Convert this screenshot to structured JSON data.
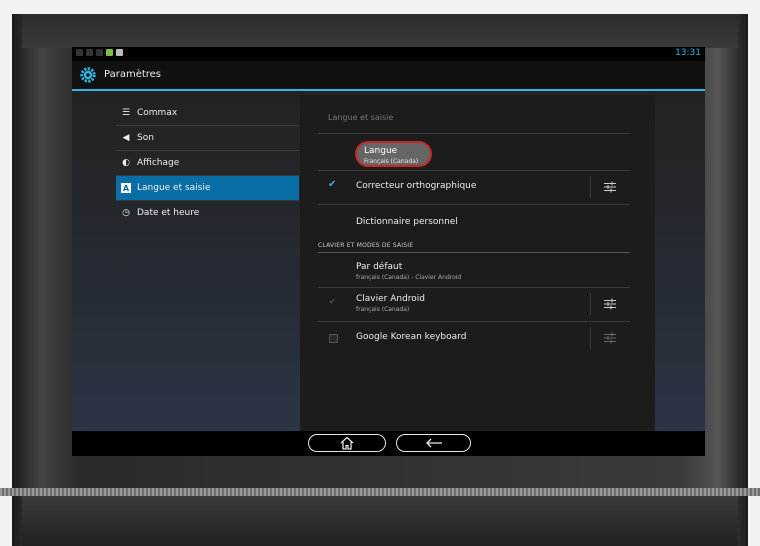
{
  "status_bar": {
    "time": "13:31"
  },
  "action_bar": {
    "title": "Paramètres",
    "icon": "gear-icon"
  },
  "sidebar": {
    "items": [
      {
        "label": "Commax",
        "icon": "list-icon",
        "active": false
      },
      {
        "label": "Son",
        "icon": "speaker-icon",
        "active": false
      },
      {
        "label": "Affichage",
        "icon": "brightness-icon",
        "active": false
      },
      {
        "label": "Langue et saisie",
        "icon": "keyboard-a-icon",
        "active": true
      },
      {
        "label": "Date et heure",
        "icon": "clock-icon",
        "active": false
      }
    ]
  },
  "detail": {
    "title": "Langue et saisie",
    "language": {
      "label": "Langue",
      "value": "Français (Canada)"
    },
    "spellcheck": {
      "label": "Correcteur orthographique",
      "checked": true
    },
    "dictionary": {
      "label": "Dictionnaire personnel"
    },
    "section_header": "CLAVIER ET MODES DE SAISIE",
    "default": {
      "label": "Par défaut",
      "value": "français (Canada) - Clavier Android"
    },
    "android_keyboard": {
      "label": "Clavier Android",
      "value": "français (Canada)",
      "checked": true
    },
    "korean_keyboard": {
      "label": "Google Korean keyboard",
      "checked": false
    }
  },
  "colors": {
    "accent": "#33b5e5",
    "active_item": "#0a6ea6",
    "highlight_ring": "#c62828"
  }
}
